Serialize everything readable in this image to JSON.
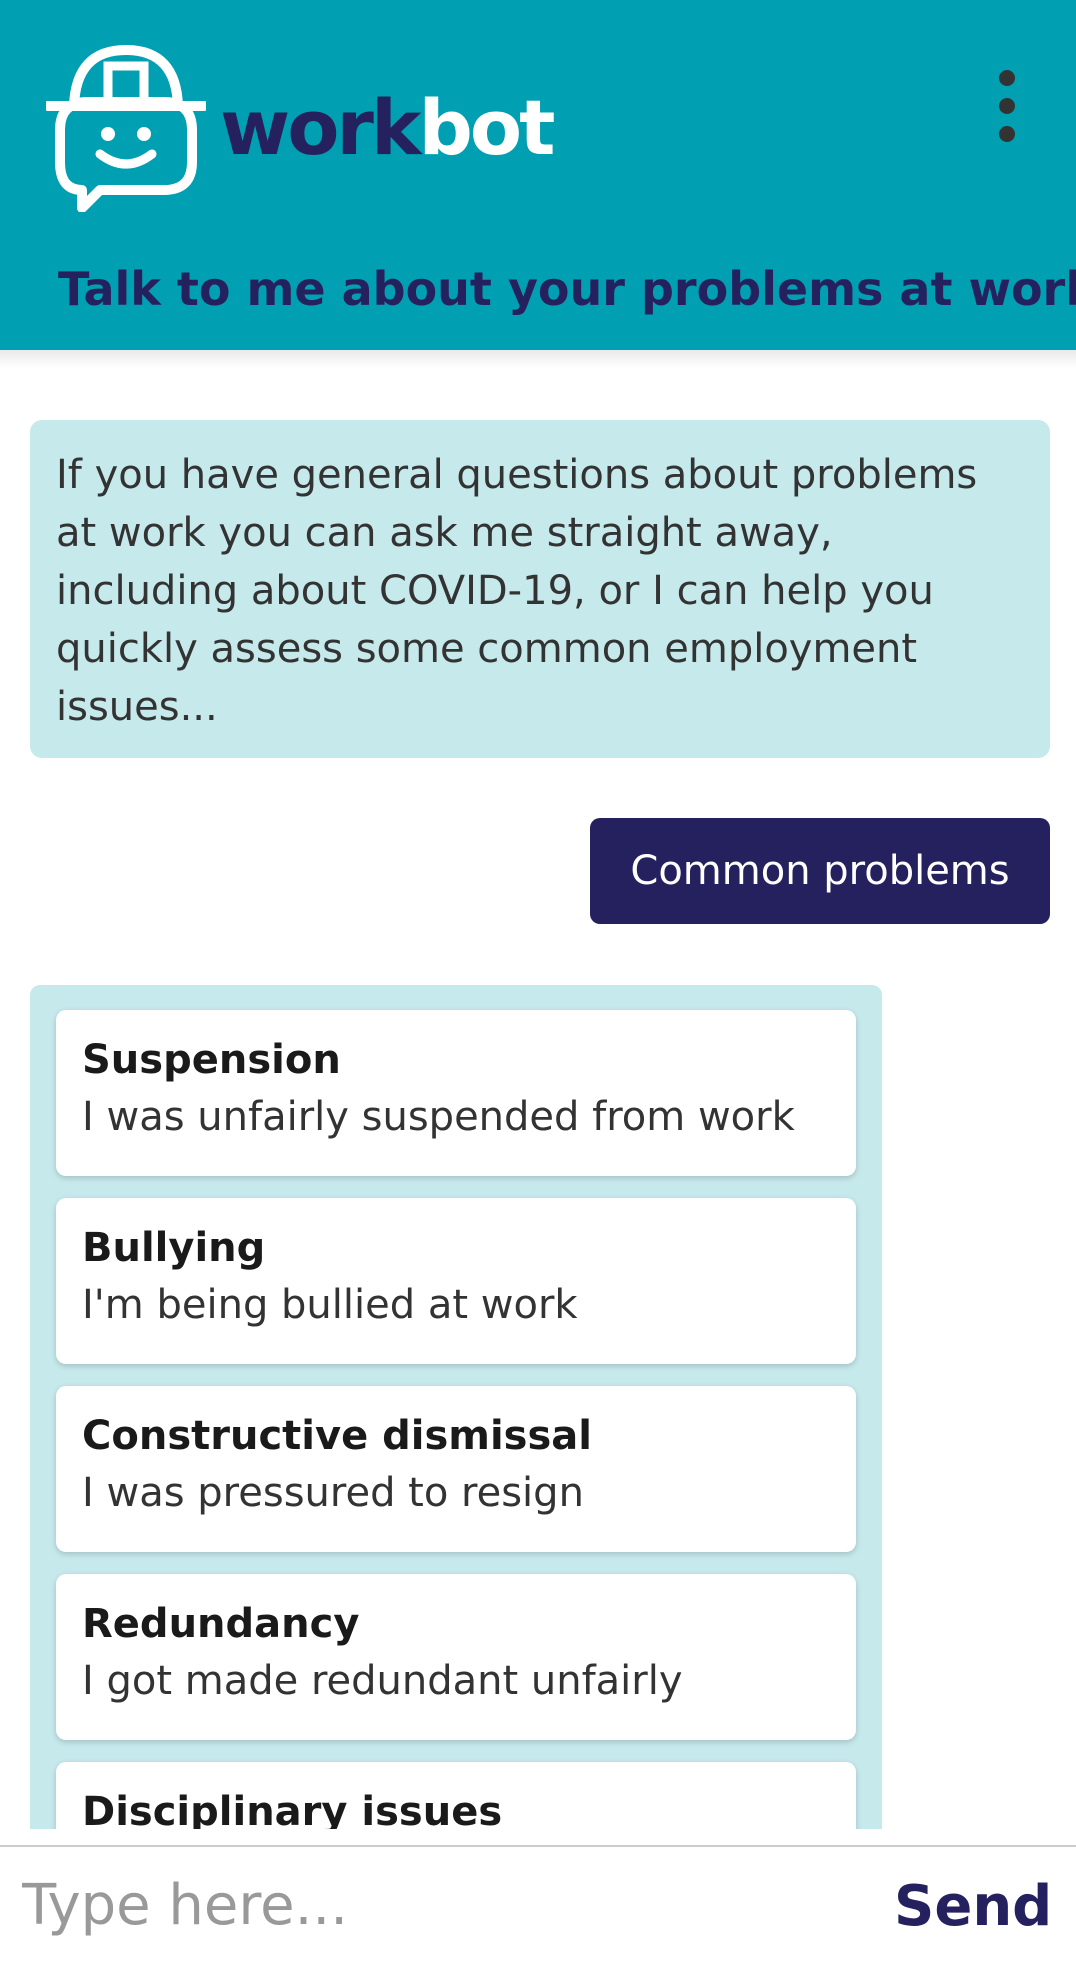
{
  "header": {
    "brand_work": "work",
    "brand_bot": "bot",
    "tagline": "Talk to me about your problems at work",
    "logo_icon": "workbot-helmet-chat-icon",
    "menu_icon": "more-vertical-icon",
    "background_color": "#00a0b2",
    "brand_color": "#25215e"
  },
  "chat": {
    "bot_message": "If you have general questions about problems at work you can ask me straight away, including about COVID-19, or I can help you quickly assess some common employment issues...",
    "user_message": "Common problems",
    "options": [
      {
        "title": "Suspension",
        "description": "I was unfairly suspended from work"
      },
      {
        "title": "Bullying",
        "description": "I'm being bullied at work"
      },
      {
        "title": "Constructive dismissal",
        "description": "I was pressured to resign"
      },
      {
        "title": "Redundancy",
        "description": "I got made redundant unfairly"
      },
      {
        "title": "Disciplinary issues",
        "description": ""
      }
    ]
  },
  "input_bar": {
    "placeholder": "Type here...",
    "send_label": "Send"
  }
}
